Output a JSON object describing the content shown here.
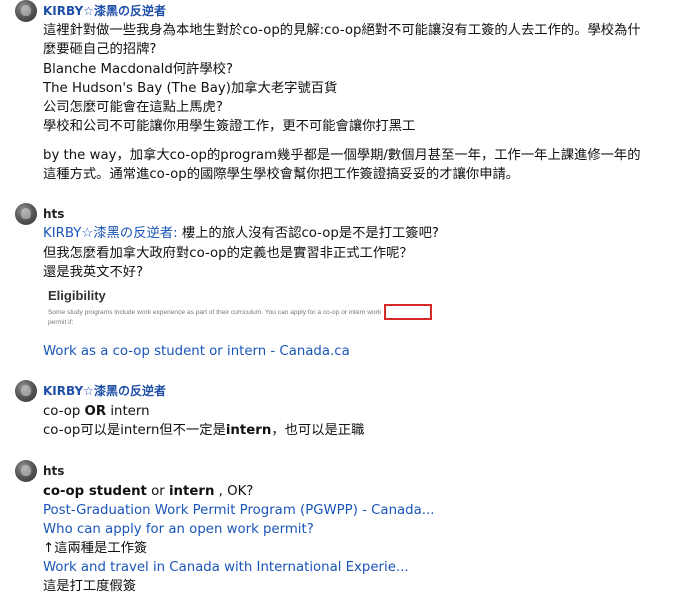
{
  "posts": [
    {
      "user": "KIRBY☆漆黑の反逆者",
      "lines": [
        "這裡針對做一些我身為本地生對於co-op的見解:co-op絕對不可能讓沒有工簽的人去工作的。學校為什",
        "麼要砸自己的招牌?",
        "Blanche Macdonald何許學校?",
        "The Hudson's Bay (The Bay)加拿大老字號百貨",
        "公司怎麼可能會在這點上馬虎?",
        "學校和公司不可能讓你用學生簽證工作，更不可能會讓你打黑工",
        "by the way，加拿大co-op的program幾乎都是一個學期/數個月甚至一年，工作一年上課進修一年的",
        "這種方式。通常進co-op的國際學生學校會幫你把工作簽證搞妥妥的才讓你申請。"
      ]
    },
    {
      "user": "hts",
      "mention": "KIRBY☆漆黑の反逆者:",
      "lines": [
        " 樓上的旅人沒有否認co-op是不是打工簽吧?",
        "但我怎麼看加拿大政府對co-op的定義也是實習非正式工作呢？",
        "還是我英文不好?"
      ],
      "image": {
        "heading": "Eligibility",
        "text1": "Some study programs include work experience as part of their curriculum. You can apply for a co-op or intern work",
        "text2": "permit if:"
      },
      "link": "Work as a co-op student or intern - Canada.ca"
    },
    {
      "user": "KIRBY☆漆黑の反逆者",
      "line1_pre": "co-op ",
      "line1_bold": "OR",
      "line1_post": " intern",
      "line2_pre": "co-op可以是intern但不一定是",
      "line2_bold": "intern",
      "line2_post": "，也可以是正職"
    },
    {
      "user": "hts",
      "line1_b1": "co-op student",
      "line1_mid": " or ",
      "line1_b2": "intern",
      "line1_post": " , OK?",
      "link1": "Post-Graduation Work Permit Program (PGWPP) - Canada...",
      "link2": "Who can apply for an open work permit?",
      "note1": "↑這兩種是工作簽",
      "link3": "Work and travel in Canada with International Experie...",
      "note2": "這是打工度假簽"
    }
  ]
}
